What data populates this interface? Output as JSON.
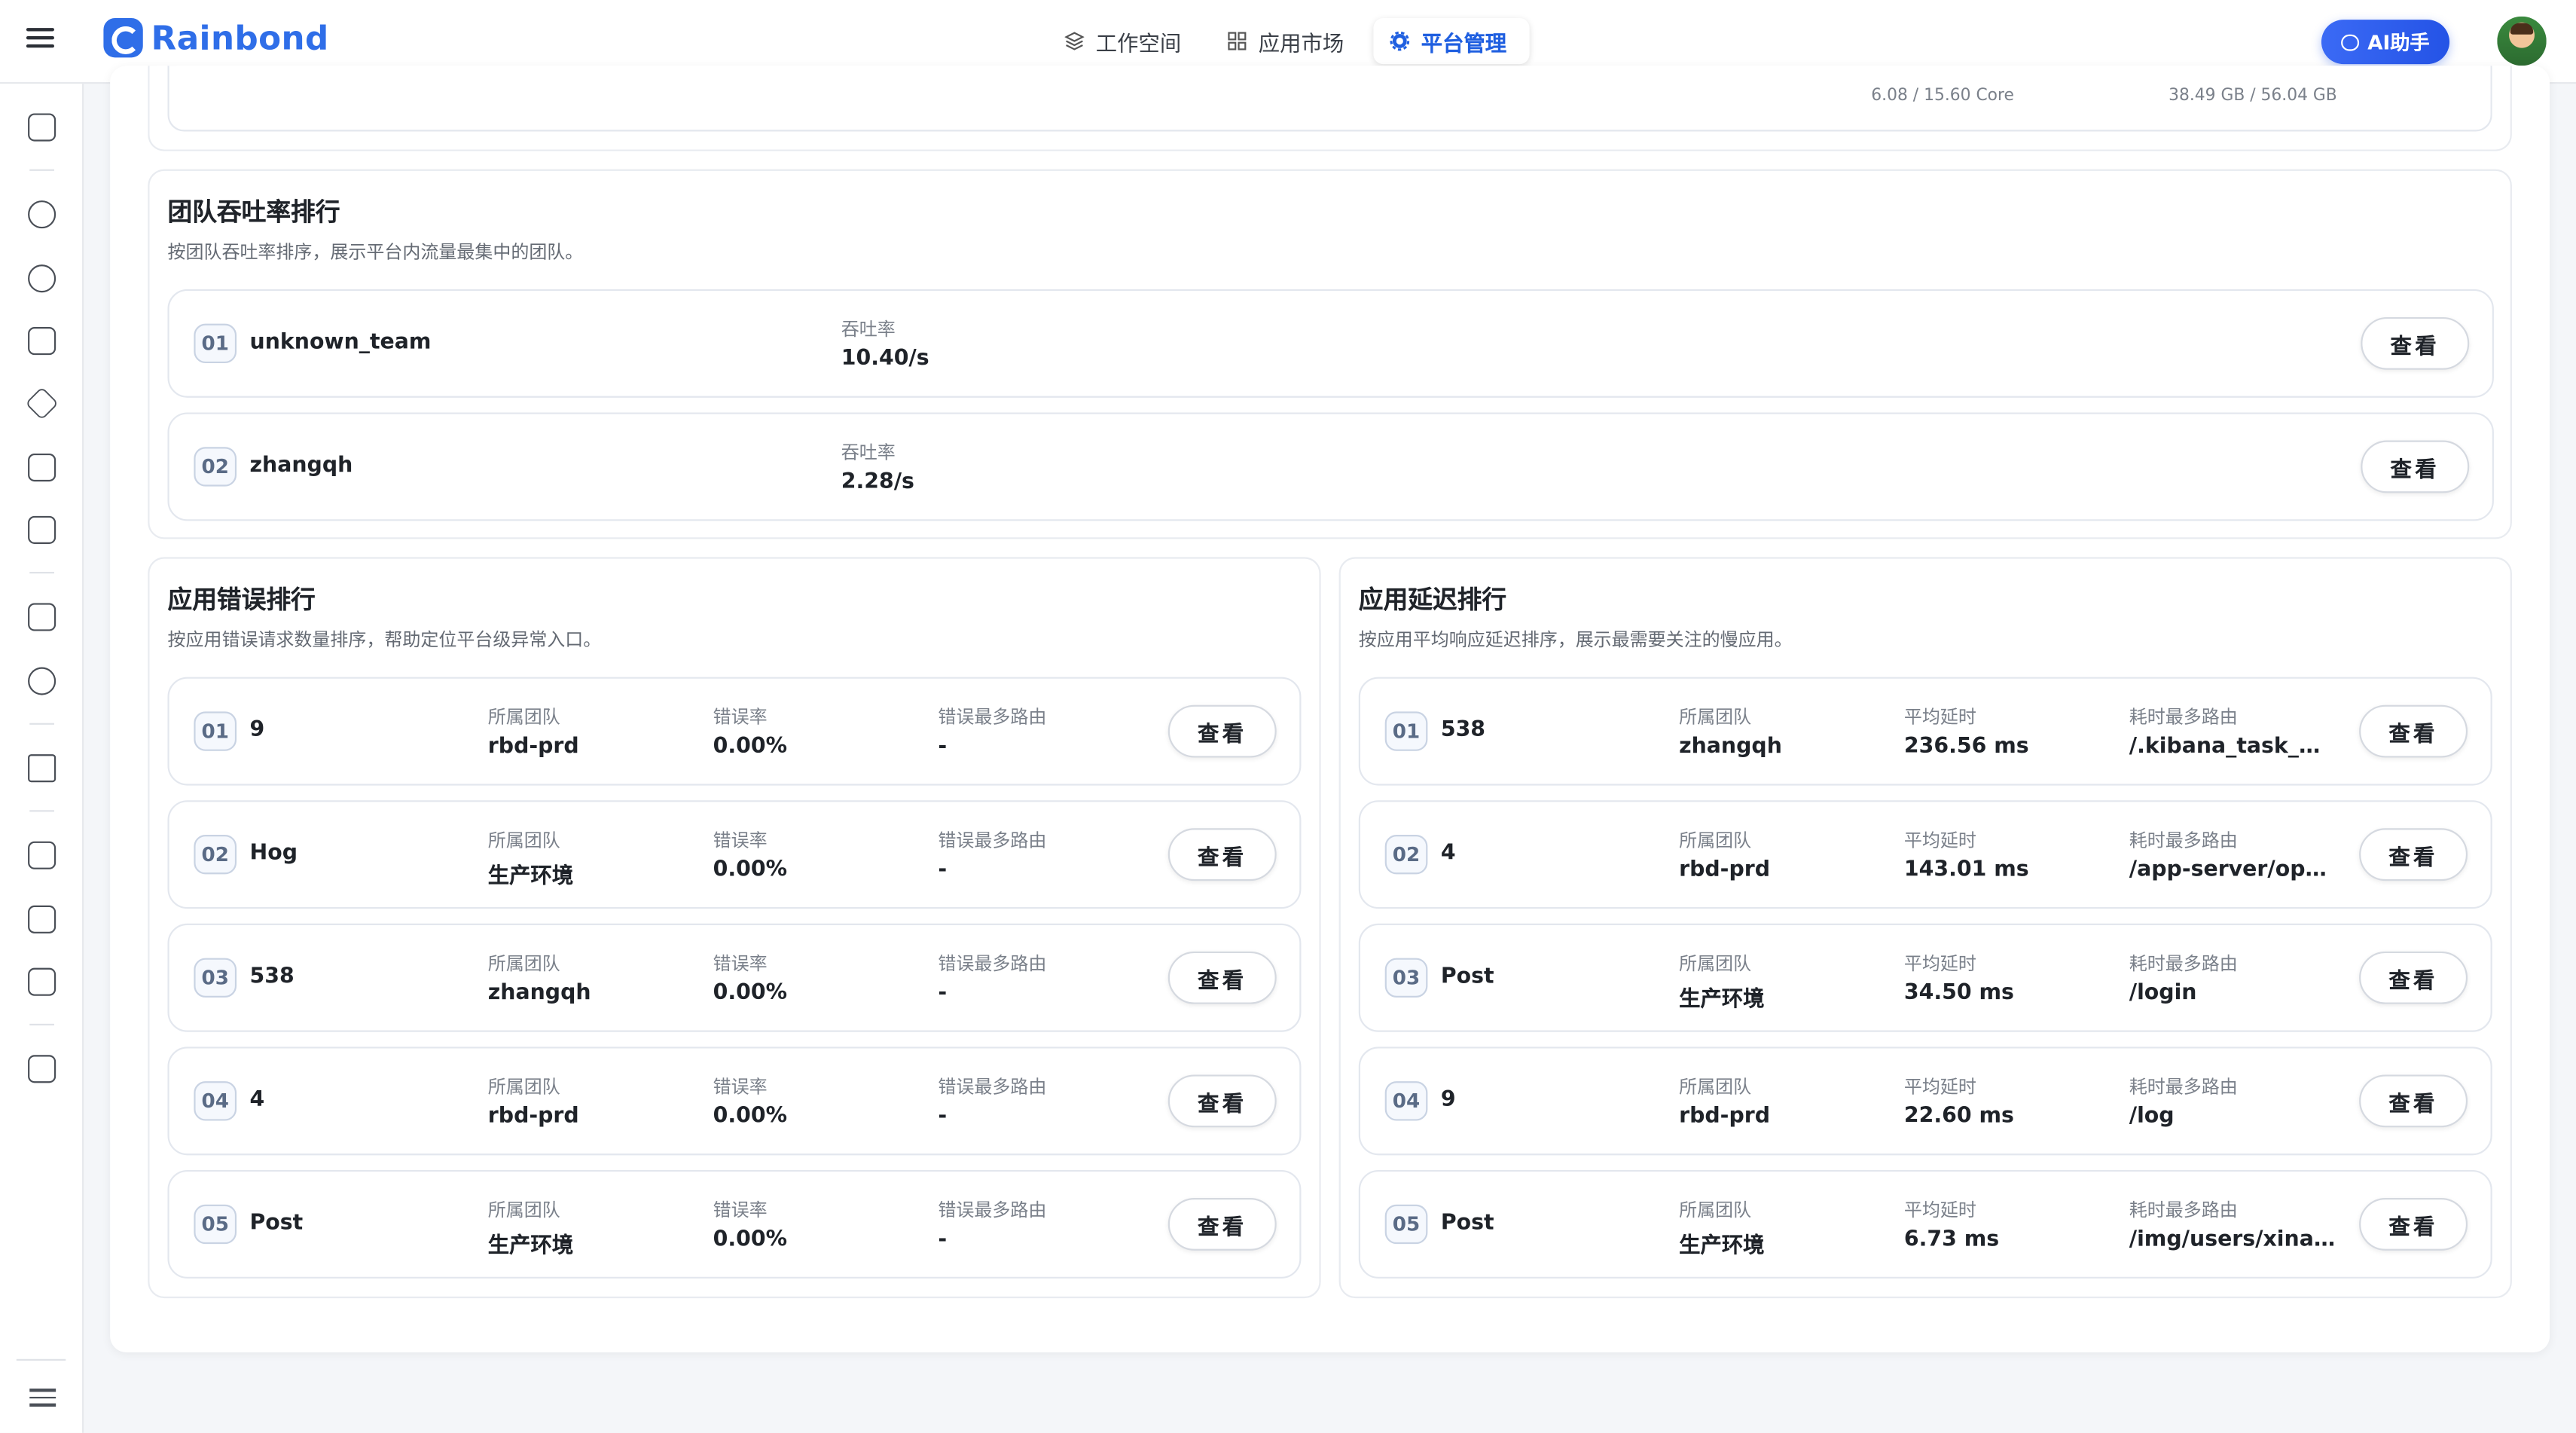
{
  "app": {
    "logo_text": "Rainbond"
  },
  "nav": [
    {
      "label": "工作空间",
      "icon": "layers-icon",
      "active": false
    },
    {
      "label": "应用市场",
      "icon": "grid-icon",
      "active": false
    },
    {
      "label": "平台管理",
      "icon": "gear-icon",
      "active": true
    }
  ],
  "ai_button": {
    "label": "AI助手"
  },
  "colors": {
    "accent": "#2f6ee8",
    "background": "#f4f6f9",
    "text": "#1f2329",
    "muted": "#7a808a"
  },
  "resource_strip": {
    "cpu": "6.08 / 15.60 Core",
    "memory": "38.49 GB / 56.04 GB"
  },
  "throughput_panel": {
    "title": "团队吞吐率排行",
    "desc": "按团队吞吐率排序，展示平台内流量最集中的团队。",
    "metric_label": "吞吐率",
    "rows": [
      {
        "rank": "01",
        "name": "unknown_team",
        "value": "10.40/s",
        "button": "查看"
      },
      {
        "rank": "02",
        "name": "zhangqh",
        "value": "2.28/s",
        "button": "查看"
      }
    ]
  },
  "error_panel": {
    "title": "应用错误排行",
    "desc": "按应用错误请求数量排序，帮助定位平台级异常入口。",
    "col_team": "所属团队",
    "col_rate": "错误率",
    "col_route": "错误最多路由",
    "rows": [
      {
        "rank": "01",
        "name": "9",
        "team": "rbd-prd",
        "rate": "0.00%",
        "route": "-",
        "button": "查看"
      },
      {
        "rank": "02",
        "name": "Hog",
        "team": "生产环境",
        "rate": "0.00%",
        "route": "-",
        "button": "查看"
      },
      {
        "rank": "03",
        "name": "538",
        "team": "zhangqh",
        "rate": "0.00%",
        "route": "-",
        "button": "查看"
      },
      {
        "rank": "04",
        "name": "4",
        "team": "rbd-prd",
        "rate": "0.00%",
        "route": "-",
        "button": "查看"
      },
      {
        "rank": "05",
        "name": "Post",
        "team": "生产环境",
        "rate": "0.00%",
        "route": "-",
        "button": "查看"
      }
    ]
  },
  "latency_panel": {
    "title": "应用延迟排行",
    "desc": "按应用平均响应延迟排序，展示最需要关注的慢应用。",
    "col_team": "所属团队",
    "col_latency": "平均延时",
    "col_route": "耗时最多路由",
    "rows": [
      {
        "rank": "01",
        "name": "538",
        "team": "zhangqh",
        "latency": "236.56 ms",
        "route": "/.kibana_task_m...",
        "button": "查看"
      },
      {
        "rank": "02",
        "name": "4",
        "team": "rbd-prd",
        "latency": "143.01 ms",
        "route": "/app-server/open...",
        "button": "查看"
      },
      {
        "rank": "03",
        "name": "Post",
        "team": "生产环境",
        "latency": "34.50 ms",
        "route": "/login",
        "button": "查看"
      },
      {
        "rank": "04",
        "name": "9",
        "team": "rbd-prd",
        "latency": "22.60 ms",
        "route": "/log",
        "button": "查看"
      },
      {
        "rank": "05",
        "name": "Post",
        "team": "生产环境",
        "latency": "6.73 ms",
        "route": "/img/users/xinan...",
        "button": "查看"
      }
    ]
  },
  "sidebar": {
    "icons": [
      "monitor-icon",
      "cluster-icon",
      "team-icon",
      "user-icon",
      "layers-icon",
      "document-icon",
      "edit-document-icon",
      "list-icon",
      "settings-icon",
      "ai-icon",
      "broadcast-icon",
      "alert-icon",
      "log-icon",
      "package-icon"
    ]
  }
}
